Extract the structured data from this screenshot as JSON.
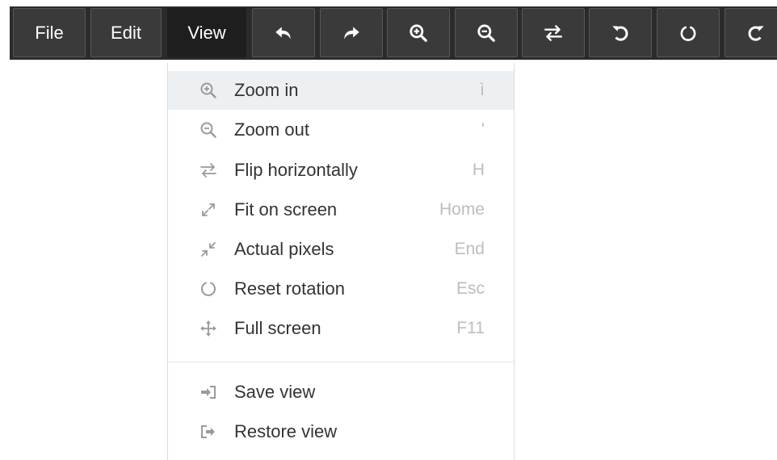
{
  "colors": {
    "toolbar_background": "#2b2b2b",
    "toolbar_button": "#3a3a3a",
    "toolbar_button_active": "#1e1e1e",
    "menu_highlight": "#edf0f3",
    "menu_text": "#333333",
    "menu_icon": "#9a9a9a",
    "shortcut_text": "#bdbdbd"
  },
  "toolbar": {
    "buttons": [
      {
        "label": "File",
        "active": false
      },
      {
        "label": "Edit",
        "active": false
      },
      {
        "label": "View",
        "active": true
      },
      {
        "icon": "undo-icon"
      },
      {
        "icon": "redo-icon"
      },
      {
        "icon": "zoom-in-icon"
      },
      {
        "icon": "zoom-out-icon"
      },
      {
        "icon": "flip-horizontal-icon"
      },
      {
        "icon": "rotate-left-icon"
      },
      {
        "icon": "reset-rotation-icon"
      },
      {
        "icon": "rotate-right-icon"
      }
    ]
  },
  "view_menu": {
    "items": [
      {
        "label": "Zoom in",
        "shortcut": "ì",
        "icon": "zoom-in-icon",
        "highlighted": true
      },
      {
        "label": "Zoom out",
        "shortcut": "'",
        "icon": "zoom-out-icon"
      },
      {
        "label": "Flip horizontally",
        "shortcut": "H",
        "icon": "flip-horizontal-icon"
      },
      {
        "label": "Fit on screen",
        "shortcut": "Home",
        "icon": "expand-icon"
      },
      {
        "label": "Actual pixels",
        "shortcut": "End",
        "icon": "compress-icon"
      },
      {
        "label": "Reset rotation",
        "shortcut": "Esc",
        "icon": "reset-rotation-icon"
      },
      {
        "label": "Full screen",
        "shortcut": "F11",
        "icon": "move-arrows-icon"
      },
      {
        "label": "Save view",
        "shortcut": "",
        "icon": "sign-in-icon"
      },
      {
        "label": "Restore view",
        "shortcut": "",
        "icon": "sign-out-icon"
      }
    ]
  }
}
